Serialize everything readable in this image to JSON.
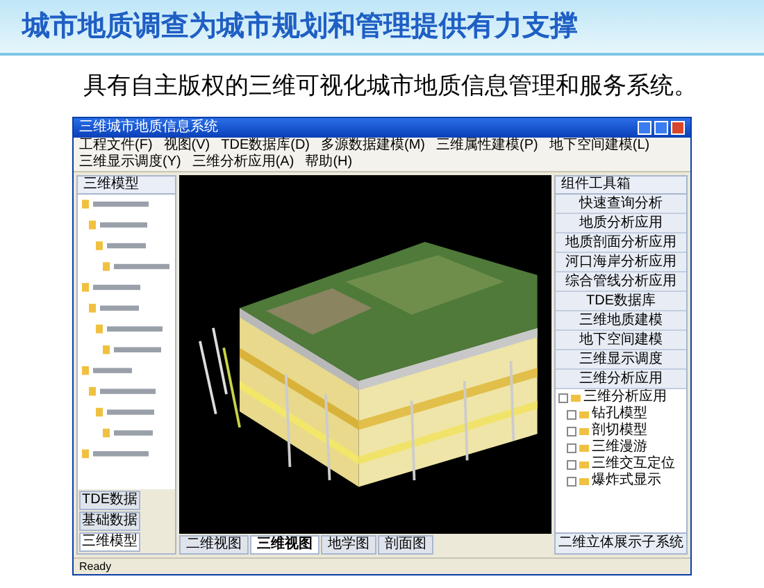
{
  "slide": {
    "title": "城市地质调查为城市规划和管理提供有力支撑",
    "subtitle": "具有自主版权的三维可视化城市地质信息管理和服务系统。"
  },
  "window": {
    "title": "三维城市地质信息系统"
  },
  "menu": [
    "工程文件(F)",
    "视图(V)",
    "TDE数据库(D)",
    "多源数据建模(M)",
    "三维属性建模(P)",
    "地下空间建模(L)",
    "三维显示调度(Y)",
    "三维分析应用(A)",
    "帮助(H)"
  ],
  "left_panel": {
    "title": "三维模型",
    "tabs": [
      {
        "label": "TDE数据",
        "selected": false
      },
      {
        "label": "基础数据",
        "selected": false
      },
      {
        "label": "三维模型",
        "selected": true
      }
    ]
  },
  "view_tabs": [
    {
      "label": "二维视图",
      "selected": false
    },
    {
      "label": "三维视图",
      "selected": true
    },
    {
      "label": "地学图",
      "selected": false
    },
    {
      "label": "剖面图",
      "selected": false
    }
  ],
  "right_panel": {
    "title": "组件工具箱",
    "buttons": [
      "快速查询分析",
      "地质分析应用",
      "地质剖面分析应用",
      "河口海岸分析应用",
      "综合管线分析应用",
      "TDE数据库",
      "三维地质建模",
      "地下空间建模",
      "三维显示调度",
      "三维分析应用"
    ],
    "tree": [
      {
        "label": "三维分析应用",
        "expanded": true,
        "children": [
          {
            "label": "钻孔模型",
            "expanded": true
          },
          {
            "label": "剖切模型",
            "expanded": true
          },
          {
            "label": "三维漫游",
            "expanded": true
          },
          {
            "label": "三维交互定位",
            "expanded": true
          },
          {
            "label": "爆炸式显示",
            "expanded": true
          }
        ]
      }
    ],
    "footer_button": "二维立体展示子系统"
  },
  "status_bar": "Ready"
}
